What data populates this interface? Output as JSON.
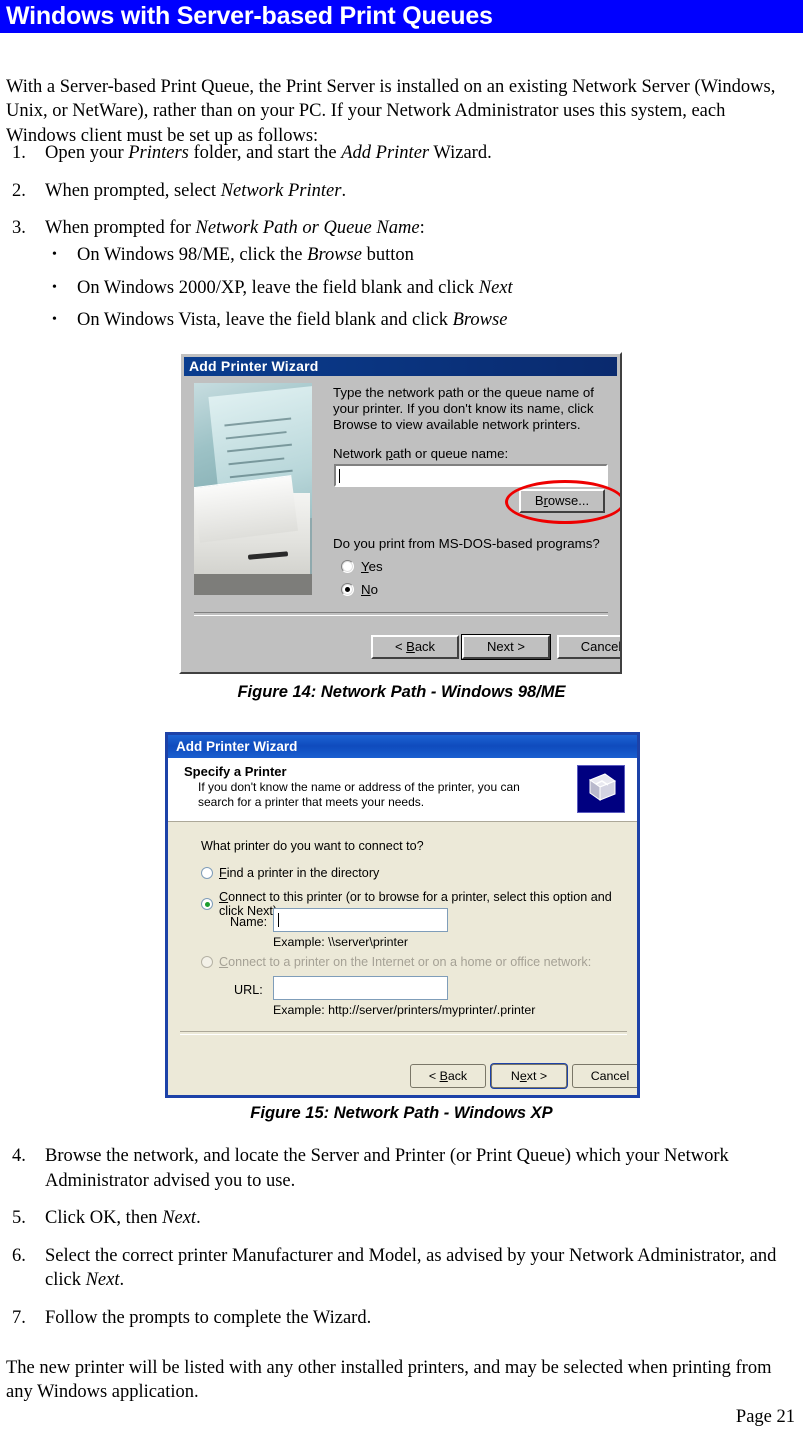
{
  "page": {
    "heading": "Windows with Server-based Print Queues",
    "footer": "Page 21",
    "intro": "With a Server-based Print Queue, the Print Server is installed on an existing Network Server (Windows, Unix, or NetWare), rather than on your PC. If your Network Administrator uses this system, each Windows client must be set up as follows:",
    "accent_color": "#0000ff"
  },
  "steps_top": [
    {
      "num": "1.",
      "text_html": "Open your <i>Printers</i> folder, and start the <i>Add Printer</i> Wizard."
    },
    {
      "num": "2.",
      "text_html": "When prompted, select <i>Network Printer</i>."
    },
    {
      "num": "3.",
      "text_html": "When prompted for <i>Network Path or Queue Name</i>:"
    }
  ],
  "bullets": [
    {
      "marker": "•",
      "text_html": "On Windows 98/ME, click the <i>Browse</i> button"
    },
    {
      "marker": "•",
      "text_html": "On Windows 2000/XP, leave the field blank and click <i>Next</i>"
    },
    {
      "marker": "•",
      "text_html": "On Windows Vista, leave the field blank and click <i>Browse</i>"
    }
  ],
  "steps_bottom": [
    {
      "num": "4.",
      "text_html": "Browse the network, and locate the Server and Printer (or Print Queue) which your Network Administrator advised you to use."
    },
    {
      "num": "5.",
      "text_html": "Click OK, then <i>Next</i>."
    },
    {
      "num": "6.",
      "text_html": "Select the correct printer Manufacturer and Model, as advised by your Network Administrator, and click <i>Next</i>."
    },
    {
      "num": "7.",
      "text_html": "Follow the prompts to complete the Wizard."
    }
  ],
  "closing": "The new printer will be listed with any other installed printers, and may be selected when printing from any Windows application.",
  "figure14": {
    "caption": "Figure 14: Network Path - Windows 98/ME",
    "title": "Add Printer Wizard",
    "intro": "Type the network path or the queue name of your printer. If you don't know its name, click Browse to view available network printers.",
    "field_label_pre": "Network ",
    "field_label_accel": "p",
    "field_label_post": "ath or queue name:",
    "field_value": "",
    "browse_pre": "B",
    "browse_accel": "r",
    "browse_post": "owse...",
    "dos_question": "Do you print from MS-DOS-based programs?",
    "radios": [
      {
        "label_accel": "Y",
        "label_rest": "es",
        "selected": false
      },
      {
        "label_accel": "N",
        "label_rest": "o",
        "selected": true
      }
    ],
    "buttons": {
      "back_pre": "< ",
      "back_accel": "B",
      "back_post": "ack",
      "next": "Next >",
      "cancel": "Cancel"
    },
    "photo_alt": "printer-photo"
  },
  "figure15": {
    "caption": "Figure 15: Network Path - Windows XP",
    "title": "Add Printer Wizard",
    "header_title": "Specify a Printer",
    "header_sub": "If you don't know the name or address of the printer, you can search for a printer that meets your needs.",
    "question": "What printer do you want to connect to?",
    "radio1_accel": "F",
    "radio1_rest": "ind a printer in the directory",
    "radio1_selected": false,
    "radio2_accel": "C",
    "radio2_rest": "onnect to this printer (or to browse for a printer, select this option and click Next):",
    "radio2_selected": true,
    "name_label": "Name:",
    "name_value": "",
    "name_example": "Example: \\\\server\\printer",
    "radio3_accel": "C",
    "radio3_rest": "onnect to a printer on the Internet or on a home or office network:",
    "radio3_selected": false,
    "radio3_disabled": true,
    "url_label": "URL:",
    "url_value": "",
    "url_example": "Example: http://server/printers/myprinter/.printer",
    "buttons": {
      "back_pre": "< ",
      "back_accel": "B",
      "back_post": "ack",
      "next_pre": "N",
      "next_accel": "e",
      "next_post": "xt >",
      "cancel": "Cancel"
    },
    "icon_name": "printer-icon"
  }
}
